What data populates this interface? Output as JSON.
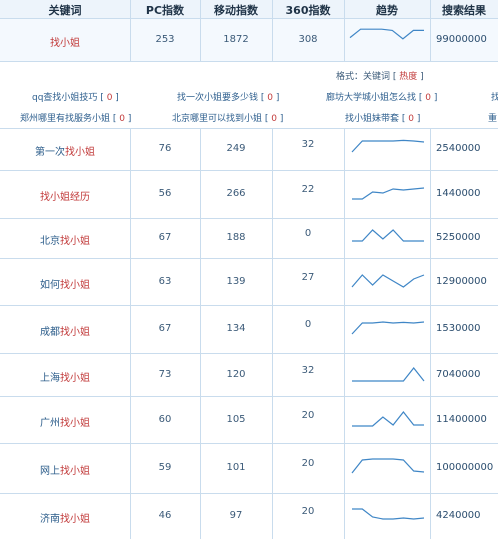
{
  "header": {
    "keyword": "关键词",
    "pc_index": "PC指数",
    "mobile_index": "移动指数",
    "index_360": "360指数",
    "trend": "趋势",
    "search_results": "搜索结果"
  },
  "main_row": {
    "keyword": "找小姐",
    "pc": "253",
    "mobile": "1872",
    "i360": "308",
    "results": "99000000",
    "trend": [
      0.6,
      0.95,
      0.95,
      0.95,
      0.9,
      0.55,
      0.9,
      0.9
    ]
  },
  "related": {
    "format_prefix": "格式：关键词",
    "format_bracket_open": "[",
    "format_hot": "热度",
    "format_bracket_close": "]",
    "items": [
      {
        "text": "qq查找小姐技巧",
        "count": "0"
      },
      {
        "text": "找一次小姐要多少钱",
        "count": "0"
      },
      {
        "text": "廊坊大学城小姐怎么找",
        "count": "0"
      },
      {
        "text": "找",
        "count": ""
      },
      {
        "text": "郑州哪里有找服务小姐",
        "count": "0"
      },
      {
        "text": "北京哪里可以找到小姐",
        "count": "0"
      },
      {
        "text": "找小姐妹带套",
        "count": "0"
      },
      {
        "text": "重",
        "count": ""
      }
    ]
  },
  "rows": [
    {
      "prefix": "第一次",
      "kw": "找小姐",
      "pc": "76",
      "mobile": "249",
      "i360": "32",
      "results": "2540000",
      "trend": [
        0.3,
        0.85,
        0.85,
        0.85,
        0.85,
        0.88,
        0.85,
        0.8
      ]
    },
    {
      "prefix": "",
      "kw": "找小姐经历",
      "pc": "56",
      "mobile": "266",
      "i360": "22",
      "results": "1440000",
      "trend": [
        0.2,
        0.2,
        0.55,
        0.5,
        0.7,
        0.65,
        0.7,
        0.75
      ]
    },
    {
      "prefix": "北京",
      "kw": "找小姐",
      "pc": "67",
      "mobile": "188",
      "i360": "0",
      "results": "5250000",
      "trend": [
        0.3,
        0.3,
        0.85,
        0.4,
        0.85,
        0.3,
        0.3,
        0.3
      ]
    },
    {
      "prefix": "如何",
      "kw": "找小姐",
      "pc": "63",
      "mobile": "139",
      "i360": "27",
      "results": "12900000",
      "trend": [
        0.2,
        0.8,
        0.3,
        0.8,
        0.5,
        0.2,
        0.6,
        0.8
      ]
    },
    {
      "prefix": "成都",
      "kw": "找小姐",
      "pc": "67",
      "mobile": "134",
      "i360": "0",
      "results": "1530000",
      "trend": [
        0.2,
        0.75,
        0.75,
        0.8,
        0.75,
        0.78,
        0.75,
        0.8
      ]
    },
    {
      "prefix": "上海",
      "kw": "找小姐",
      "pc": "73",
      "mobile": "120",
      "i360": "32",
      "results": "7040000",
      "trend": [
        0.15,
        0.15,
        0.15,
        0.15,
        0.15,
        0.15,
        0.8,
        0.15
      ]
    },
    {
      "prefix": "广州",
      "kw": "找小姐",
      "pc": "60",
      "mobile": "105",
      "i360": "20",
      "results": "11400000",
      "trend": [
        0.15,
        0.15,
        0.15,
        0.6,
        0.2,
        0.85,
        0.2,
        0.2
      ]
    },
    {
      "prefix": "网上",
      "kw": "找小姐",
      "pc": "59",
      "mobile": "101",
      "i360": "20",
      "results": "100000000",
      "trend": [
        0.2,
        0.85,
        0.9,
        0.9,
        0.9,
        0.85,
        0.3,
        0.25
      ]
    },
    {
      "prefix": "济南",
      "kw": "找小姐",
      "pc": "46",
      "mobile": "97",
      "i360": "20",
      "results": "4240000",
      "trend": [
        0.8,
        0.8,
        0.4,
        0.3,
        0.3,
        0.35,
        0.3,
        0.35
      ]
    }
  ],
  "colors": {
    "border": "#c9dced",
    "header_bg": "#edf4fb",
    "keyword_red": "#c23b3b",
    "trend_line": "#3f86c6"
  }
}
